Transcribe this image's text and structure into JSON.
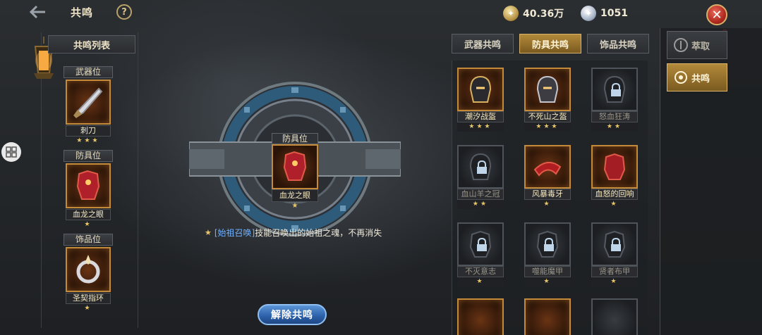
{
  "header": {
    "title": "共鸣",
    "help_label": "?",
    "close_label": "✕"
  },
  "currency": {
    "gold_amount": "40.36万",
    "silver_amount": "1051"
  },
  "left_panel": {
    "list_title": "共鸣列表",
    "slots": [
      {
        "label": "武器位",
        "item_name": "刺刀",
        "stars": "★★★"
      },
      {
        "label": "防具位",
        "item_name": "血龙之眼",
        "stars": "★"
      },
      {
        "label": "饰品位",
        "item_name": "圣契指环",
        "stars": "★"
      }
    ]
  },
  "center": {
    "slot_label": "防具位",
    "item_name": "血龙之眼",
    "stars": "★",
    "skill_tag": "[始祖召唤]",
    "skill_desc": "技能召唤出的始祖之魂，不再消失",
    "release_label": "解除共鸣"
  },
  "tabs": [
    {
      "label": "武器共鸣",
      "active": false
    },
    {
      "label": "防具共鸣",
      "active": true
    },
    {
      "label": "饰品共鸣",
      "active": false
    }
  ],
  "grid": [
    {
      "name": "潮汐战盔",
      "stars": "★★★",
      "owned": true
    },
    {
      "name": "不死山之盔",
      "stars": "★★★",
      "owned": true
    },
    {
      "name": "怒血狂涛",
      "stars": "★★",
      "owned": false
    },
    {
      "name": "血山羊之冠",
      "stars": "★★",
      "owned": false
    },
    {
      "name": "风暴毒牙",
      "stars": "★",
      "owned": true
    },
    {
      "name": "血怒的回响",
      "stars": "★",
      "owned": true
    },
    {
      "name": "不灭意志",
      "stars": "★",
      "owned": false
    },
    {
      "name": "噬能魔甲",
      "stars": "★",
      "owned": false
    },
    {
      "name": "贤者布甲",
      "stars": "★",
      "owned": false
    }
  ],
  "side_panel": {
    "buttons": [
      {
        "label": "萃取",
        "active": false
      },
      {
        "label": "共鸣",
        "active": true
      }
    ]
  },
  "colors": {
    "accent_gold": "#c48a3a",
    "active_tab": "#b38a3a",
    "release_blue": "#2b5fa8",
    "skill_tag_blue": "#6fb0ff",
    "star_gold": "#e8c66a"
  }
}
